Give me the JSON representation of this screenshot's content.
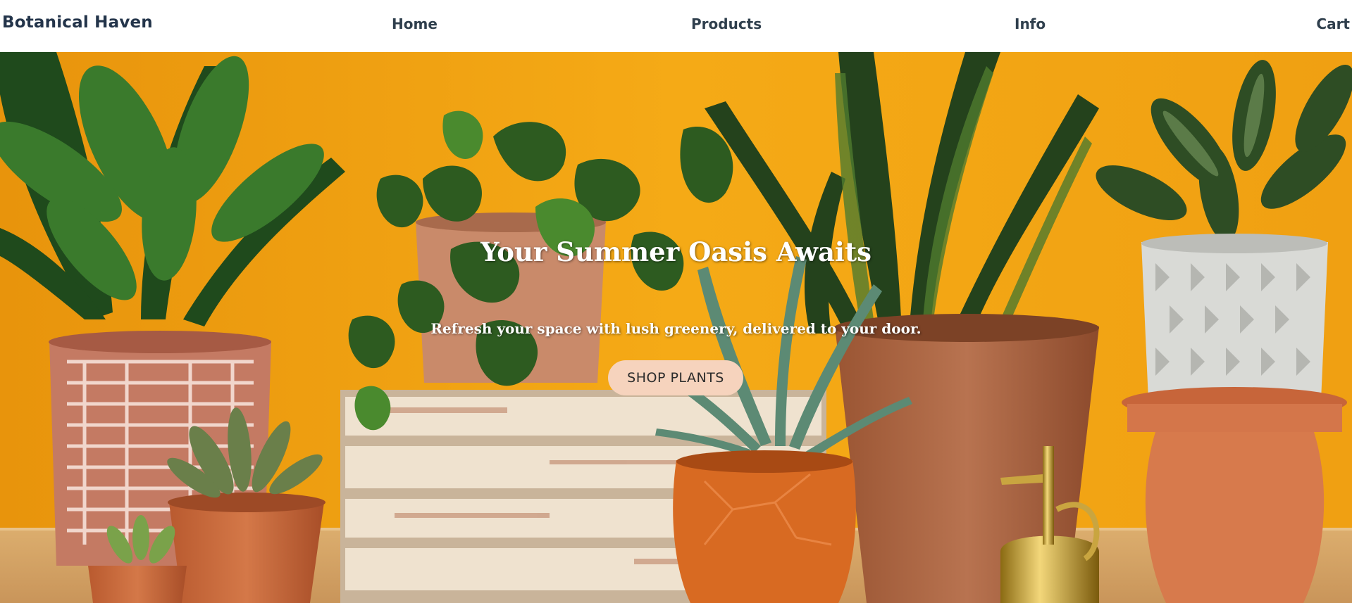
{
  "nav": {
    "brand": "Botanical Haven",
    "links": [
      "Home",
      "Products",
      "Info",
      "Cart"
    ]
  },
  "hero": {
    "title": "Your Summer Oasis Awaits",
    "subtitle": "Refresh your space with lush greenery, delivered to your door.",
    "cta_label": "SHOP PLANTS",
    "image_description_colors": {
      "wall": "#f2a414",
      "table": "#d6a564",
      "terracotta": "#c86a3c",
      "leaf_dark": "#1f4a1c",
      "leaf_mid": "#3a7a2c"
    }
  },
  "colors": {
    "brand_text": "#23344a",
    "nav_text": "#2f3f4d",
    "cta_bg": "#f6d3bd"
  }
}
